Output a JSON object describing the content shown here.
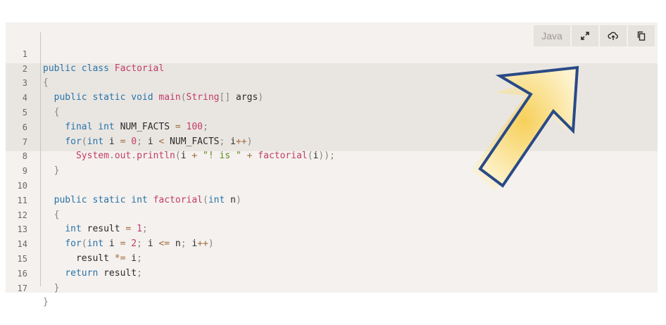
{
  "toolbar": {
    "language_label": "Java",
    "icons": [
      "expand-icon",
      "cloud-upload-icon",
      "copy-icon"
    ]
  },
  "code": {
    "line_numbers": [
      "1",
      "2",
      "3",
      "4",
      "5",
      "6",
      "7",
      "8",
      "9",
      "10",
      "11",
      "12",
      "13",
      "14",
      "15",
      "16",
      "17"
    ],
    "highlighted_lines": [
      3,
      8
    ]
  },
  "colors": {
    "keyword": "#2a73a8",
    "function": "#c23b6a",
    "string": "#5f8a1f",
    "background": "#f4f1ee",
    "highlight": "#e9e6e2",
    "arrow_fill": "#f7d97a",
    "arrow_stroke": "#2a4a86"
  }
}
